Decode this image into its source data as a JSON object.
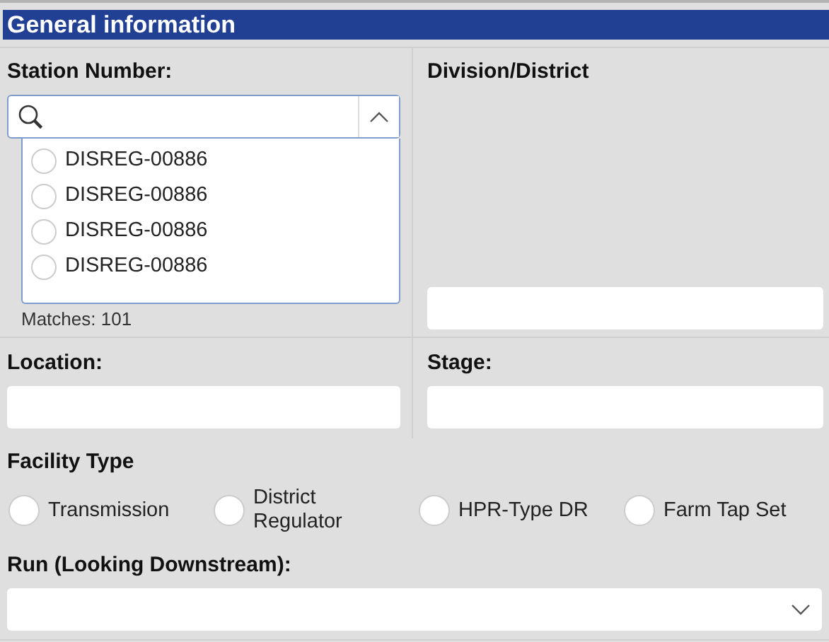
{
  "section": {
    "title": "General information"
  },
  "station_number": {
    "label": "Station Number:",
    "expanded": true,
    "options": [
      {
        "label": "DISREG-00886",
        "selected": false
      },
      {
        "label": "DISREG-00886",
        "selected": false
      },
      {
        "label": "DISREG-00886",
        "selected": false
      },
      {
        "label": "DISREG-00886",
        "selected": false
      }
    ],
    "matches": "Matches: 101"
  },
  "division_district": {
    "label": "Division/District"
  },
  "location": {
    "label": "Location:"
  },
  "stage": {
    "label": "Stage:"
  },
  "facility_type": {
    "label": "Facility Type",
    "options": [
      {
        "label": "Transmission",
        "selected": false
      },
      {
        "label": "District Regulator",
        "selected": false
      },
      {
        "label": "HPR-Type DR",
        "selected": false
      },
      {
        "label": "Farm Tap Set",
        "selected": false
      }
    ]
  },
  "run": {
    "label": "Run (Looking Downstream):"
  }
}
